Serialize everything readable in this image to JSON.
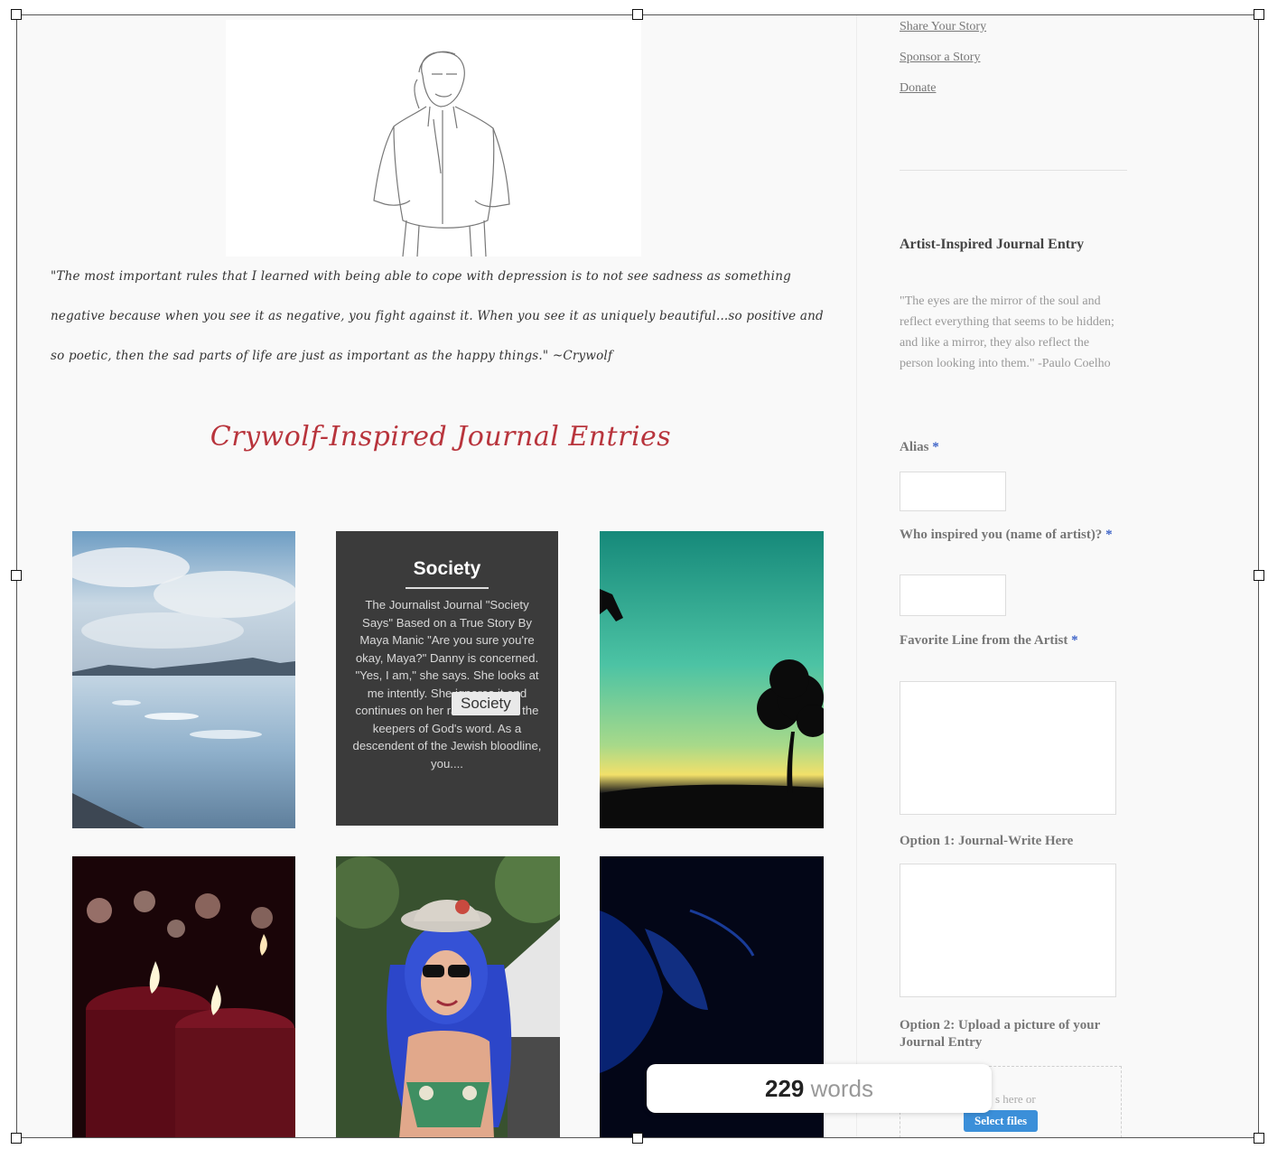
{
  "article": {
    "quote": "\"The most important rules that I learned with being able to cope with depression is to not see sadness as something negative because when you see it as negative, you fight against it. When you see it as uniquely beautiful...so positive and so poetic, then the sad parts of life are just as important as the happy things.\" ~Crywolf",
    "section_title": "Crywolf-Inspired Journal Entries"
  },
  "grid": {
    "society_title": "Society",
    "society_excerpt": "The Journalist Journal \"Society Says\" Based on a True Story By Maya Manic \"Are you sure you're okay, Maya?\" Danny is concerned. \"Yes, I am,\" she says. She looks at me intently. She ignores it and continues on her rant. \"You are the keepers of God's word. As a descendent of the Jewish bloodline, you....",
    "society_tag": "Society"
  },
  "sidebar": {
    "links": [
      "Share Your Story",
      "Sponsor a Story",
      "Donate"
    ],
    "form_title": "Artist-Inspired Journal Entry",
    "form_quote": "\"The eyes are the mirror of the soul and reflect everything that seems to be hidden; and like a mirror, they also reflect the person looking into them.\" -Paulo Coelho",
    "alias_label": "Alias",
    "artist_label": "Who inspired you (name of artist)?",
    "favorite_line_label": "Favorite Line from the Artist",
    "option1_label": "Option 1: Journal-Write Here",
    "option2_label": "Option 2: Upload a picture of your Journal Entry",
    "drop_text": "s here or",
    "select_button": "Select files",
    "required_mark": "*"
  },
  "counter": {
    "count": "229",
    "unit": "words"
  },
  "colors": {
    "title_red": "#b8343c",
    "required_blue": "#3d63c8",
    "society_bg": "#3b3b3b"
  }
}
